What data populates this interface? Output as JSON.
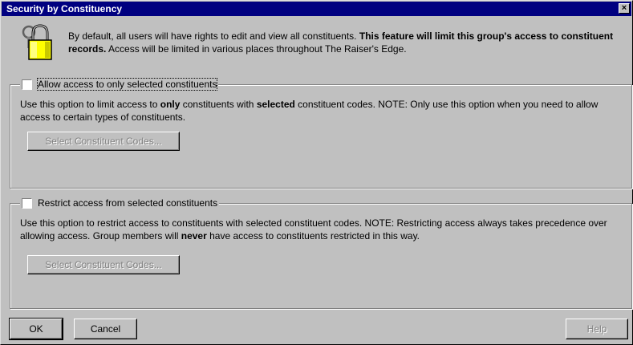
{
  "window": {
    "title": "Security by Constituency",
    "close_label": "×"
  },
  "intro": {
    "icon": "lock-keys-icon",
    "text_before": "By default, all users will have rights to edit and view all constituents. ",
    "text_bold": "This feature will limit this group's access to constituent records.",
    "text_after": " Access will be limited in various places throughout The Raiser's Edge."
  },
  "allow_group": {
    "checkbox_label": "Allow access to only selected constituents",
    "checked": false,
    "desc_1": "Use this option to limit access to ",
    "desc_bold_1": "only",
    "desc_2": " constituents with ",
    "desc_bold_2": "selected",
    "desc_3": " constituent codes.  NOTE: Only use this option when you need to allow access to certain types of constituents.",
    "button_label": "Select Constituent Codes..."
  },
  "restrict_group": {
    "checkbox_label": "Restrict access from selected constituents",
    "checked": false,
    "desc_1": "Use this option to restrict access to constituents with selected constituent codes.  NOTE: Restricting access always takes precedence over allowing access.  Group members will ",
    "desc_bold_1": "never",
    "desc_2": " have access to constituents restricted in this way.",
    "button_label": "Select Constituent Codes..."
  },
  "footer": {
    "ok_label": "OK",
    "cancel_label": "Cancel",
    "help_label": "Help"
  }
}
